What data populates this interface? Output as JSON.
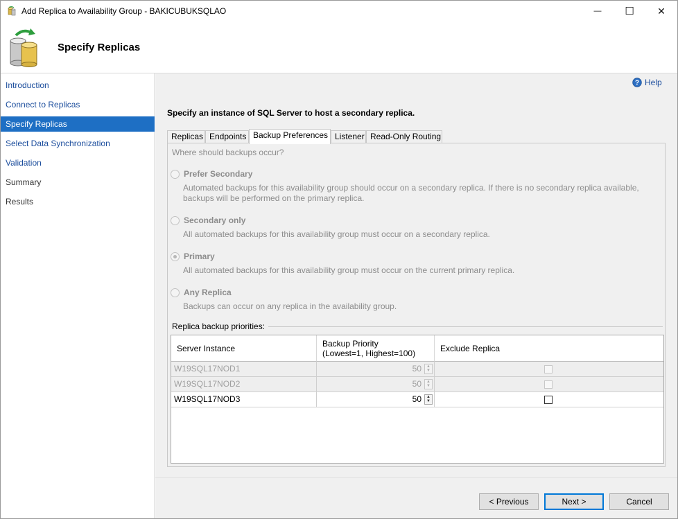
{
  "window": {
    "title": "Add Replica to Availability Group - BAKICUBUKSQLAO",
    "min_glyph": "—",
    "max_glyph": "☐",
    "close_glyph": "✕"
  },
  "header": {
    "title": "Specify Replicas"
  },
  "sidebar": {
    "items": [
      {
        "label": "Introduction",
        "state": "link"
      },
      {
        "label": "Connect to Replicas",
        "state": "link"
      },
      {
        "label": "Specify Replicas",
        "state": "active"
      },
      {
        "label": "Select Data Synchronization",
        "state": "link"
      },
      {
        "label": "Validation",
        "state": "link"
      },
      {
        "label": "Summary",
        "state": "plain"
      },
      {
        "label": "Results",
        "state": "plain"
      }
    ]
  },
  "content": {
    "help_label": "Help",
    "instruction": "Specify an instance of SQL Server to host a secondary replica.",
    "tabs": [
      "Replicas",
      "Endpoints",
      "Backup Preferences",
      "Listener",
      "Read-Only Routing"
    ],
    "active_tab": "Backup Preferences",
    "question": "Where should backups occur?",
    "options": [
      {
        "label": "Prefer Secondary",
        "desc1": "Automated backups for this availability group should occur on a secondary replica. If there is no secondary replica available,",
        "desc2": "backups will be performed on the primary replica.",
        "checked": false
      },
      {
        "label": "Secondary only",
        "desc1": "All automated backups for this availability group must occur on a secondary replica.",
        "desc2": "",
        "checked": false
      },
      {
        "label": "Primary",
        "desc1": "All automated backups for this availability group must occur on the current primary replica.",
        "desc2": "",
        "checked": true
      },
      {
        "label": "Any Replica",
        "desc1": "Backups can occur on any replica in the availability group.",
        "desc2": "",
        "checked": false
      }
    ],
    "priorities_label": "Replica backup priorities:",
    "grid": {
      "headers": {
        "server": "Server Instance",
        "priority_line1": "Backup Priority",
        "priority_line2": "(Lowest=1, Highest=100)",
        "exclude": "Exclude Replica"
      },
      "rows": [
        {
          "server": "W19SQL17NOD1",
          "priority": "50",
          "disabled": true
        },
        {
          "server": "W19SQL17NOD2",
          "priority": "50",
          "disabled": true
        },
        {
          "server": "W19SQL17NOD3",
          "priority": "50",
          "disabled": false
        }
      ],
      "spin_up": "▲",
      "spin_down": "▼"
    }
  },
  "footer": {
    "previous": "< Previous",
    "next": "Next >",
    "cancel": "Cancel"
  },
  "colors": {
    "accent": "#1e6fc4",
    "link": "#1a4c9c"
  }
}
